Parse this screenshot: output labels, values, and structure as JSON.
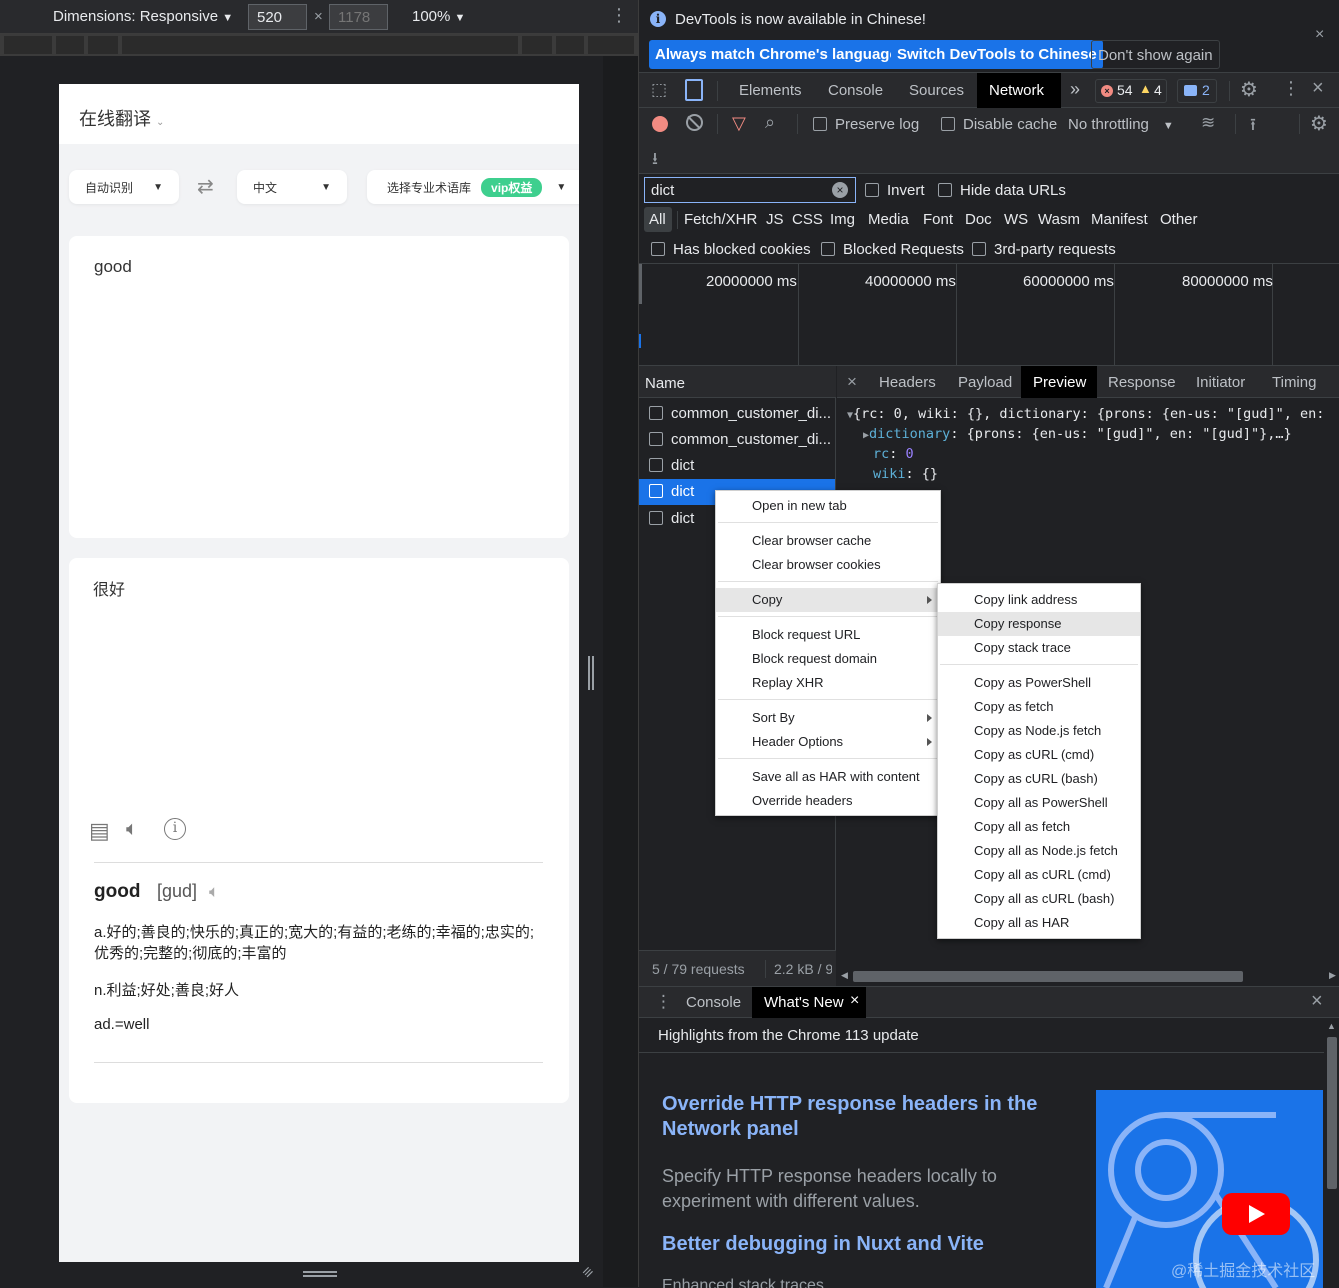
{
  "device_toolbar": {
    "dimensions_label": "Dimensions: Responsive",
    "width_value": "520",
    "height_placeholder": "1178",
    "zoom": "100%"
  },
  "page": {
    "header_title": "在线翻译",
    "source_lang": "自动识别",
    "target_lang": "中文",
    "glossary_label": "选择专业术语库",
    "vip_badge": "vip权益",
    "input_text": "good",
    "output_text": "很好",
    "dict_word": "good",
    "dict_phonetic": "[gud]",
    "definitions": [
      "a.好的;善良的;快乐的;真正的;宽大的;有益的;老练的;幸福的;忠实的;优秀的;完整的;彻底的;丰富的",
      "n.利益;好处;善良;好人",
      "ad.=well"
    ]
  },
  "notification": {
    "message": "DevTools is now available in Chinese!",
    "btn_match": "Always match Chrome's language",
    "btn_switch": "Switch DevTools to Chinese",
    "btn_dismiss": "Don't show again"
  },
  "main_tabs": [
    "Elements",
    "Console",
    "Sources",
    "Network"
  ],
  "badges": {
    "errors": "54",
    "warnings": "4",
    "messages": "2"
  },
  "network_toolbar": {
    "preserve_log": "Preserve log",
    "disable_cache": "Disable cache",
    "throttling": "No throttling"
  },
  "filter": {
    "value": "dict",
    "invert": "Invert",
    "hide_data_urls": "Hide data URLs",
    "types": [
      "All",
      "Fetch/XHR",
      "JS",
      "CSS",
      "Img",
      "Media",
      "Font",
      "Doc",
      "WS",
      "Wasm",
      "Manifest",
      "Other"
    ],
    "has_blocked_cookies": "Has blocked cookies",
    "blocked_requests": "Blocked Requests",
    "third_party": "3rd-party requests"
  },
  "timeline_ticks": [
    "20000000 ms",
    "40000000 ms",
    "60000000 ms",
    "80000000 ms"
  ],
  "request_list": {
    "header": "Name",
    "rows": [
      "common_customer_di...",
      "common_customer_di...",
      "dict",
      "dict",
      "dict"
    ],
    "status_requests": "5 / 79 requests",
    "status_size": "2.2 kB / 9"
  },
  "detail_tabs": [
    "Headers",
    "Payload",
    "Preview",
    "Response",
    "Initiator",
    "Timing"
  ],
  "preview": {
    "line1": "{rc: 0, wiki: {}, dictionary: {prons: {en-us: \"[gud]\", en:",
    "line2_key": "dictionary",
    "line2_val": "{prons: {en-us: \"[gud]\", en: \"[gud]\"},…}",
    "line3_key": "rc",
    "line3_val": "0",
    "line4_key": "wiki",
    "line4_val": "{}"
  },
  "context_menu": {
    "open_new_tab": "Open in new tab",
    "clear_cache": "Clear browser cache",
    "clear_cookies": "Clear browser cookies",
    "copy": "Copy",
    "block_url": "Block request URL",
    "block_domain": "Block request domain",
    "replay_xhr": "Replay XHR",
    "sort_by": "Sort By",
    "header_options": "Header Options",
    "save_har": "Save all as HAR with content",
    "override_headers": "Override headers"
  },
  "copy_submenu": [
    "Copy link address",
    "Copy response",
    "Copy stack trace",
    "Copy as PowerShell",
    "Copy as fetch",
    "Copy as Node.js fetch",
    "Copy as cURL (cmd)",
    "Copy as cURL (bash)",
    "Copy all as PowerShell",
    "Copy all as fetch",
    "Copy all as Node.js fetch",
    "Copy all as cURL (cmd)",
    "Copy all as cURL (bash)",
    "Copy all as HAR"
  ],
  "drawer": {
    "tab_console": "Console",
    "tab_whats_new": "What's New",
    "highlights": "Highlights from the Chrome 113 update",
    "article1_title": "Override HTTP response headers in the Network panel",
    "article1_desc": "Specify HTTP response headers locally to experiment with different values.",
    "article2_title": "Better debugging in Nuxt and Vite",
    "watermark": "@稀土掘金技术社区"
  },
  "colors": {
    "accent_blue": "#8ab4f8",
    "button_blue": "#1a73e8",
    "vip_green": "#3ecf8e"
  }
}
